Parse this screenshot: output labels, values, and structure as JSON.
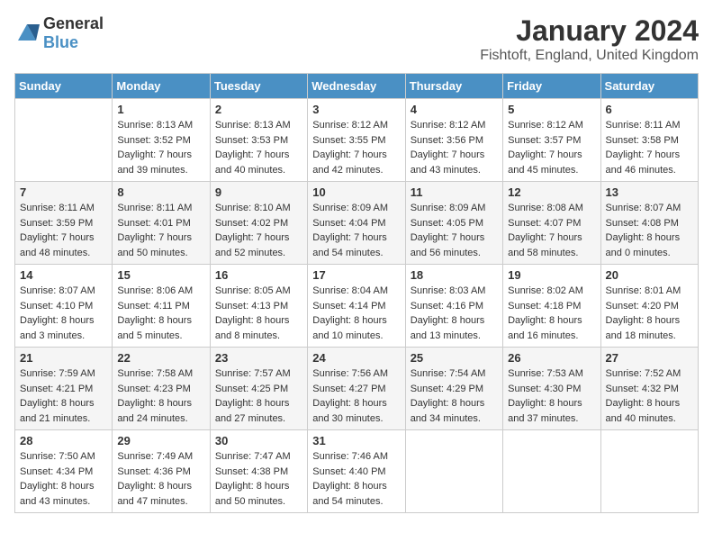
{
  "header": {
    "logo_general": "General",
    "logo_blue": "Blue",
    "month_title": "January 2024",
    "location": "Fishtoft, England, United Kingdom"
  },
  "weekdays": [
    "Sunday",
    "Monday",
    "Tuesday",
    "Wednesday",
    "Thursday",
    "Friday",
    "Saturday"
  ],
  "weeks": [
    [
      {
        "day": "",
        "sunrise": "",
        "sunset": "",
        "daylight": ""
      },
      {
        "day": "1",
        "sunrise": "Sunrise: 8:13 AM",
        "sunset": "Sunset: 3:52 PM",
        "daylight": "Daylight: 7 hours and 39 minutes."
      },
      {
        "day": "2",
        "sunrise": "Sunrise: 8:13 AM",
        "sunset": "Sunset: 3:53 PM",
        "daylight": "Daylight: 7 hours and 40 minutes."
      },
      {
        "day": "3",
        "sunrise": "Sunrise: 8:12 AM",
        "sunset": "Sunset: 3:55 PM",
        "daylight": "Daylight: 7 hours and 42 minutes."
      },
      {
        "day": "4",
        "sunrise": "Sunrise: 8:12 AM",
        "sunset": "Sunset: 3:56 PM",
        "daylight": "Daylight: 7 hours and 43 minutes."
      },
      {
        "day": "5",
        "sunrise": "Sunrise: 8:12 AM",
        "sunset": "Sunset: 3:57 PM",
        "daylight": "Daylight: 7 hours and 45 minutes."
      },
      {
        "day": "6",
        "sunrise": "Sunrise: 8:11 AM",
        "sunset": "Sunset: 3:58 PM",
        "daylight": "Daylight: 7 hours and 46 minutes."
      }
    ],
    [
      {
        "day": "7",
        "sunrise": "Sunrise: 8:11 AM",
        "sunset": "Sunset: 3:59 PM",
        "daylight": "Daylight: 7 hours and 48 minutes."
      },
      {
        "day": "8",
        "sunrise": "Sunrise: 8:11 AM",
        "sunset": "Sunset: 4:01 PM",
        "daylight": "Daylight: 7 hours and 50 minutes."
      },
      {
        "day": "9",
        "sunrise": "Sunrise: 8:10 AM",
        "sunset": "Sunset: 4:02 PM",
        "daylight": "Daylight: 7 hours and 52 minutes."
      },
      {
        "day": "10",
        "sunrise": "Sunrise: 8:09 AM",
        "sunset": "Sunset: 4:04 PM",
        "daylight": "Daylight: 7 hours and 54 minutes."
      },
      {
        "day": "11",
        "sunrise": "Sunrise: 8:09 AM",
        "sunset": "Sunset: 4:05 PM",
        "daylight": "Daylight: 7 hours and 56 minutes."
      },
      {
        "day": "12",
        "sunrise": "Sunrise: 8:08 AM",
        "sunset": "Sunset: 4:07 PM",
        "daylight": "Daylight: 7 hours and 58 minutes."
      },
      {
        "day": "13",
        "sunrise": "Sunrise: 8:07 AM",
        "sunset": "Sunset: 4:08 PM",
        "daylight": "Daylight: 8 hours and 0 minutes."
      }
    ],
    [
      {
        "day": "14",
        "sunrise": "Sunrise: 8:07 AM",
        "sunset": "Sunset: 4:10 PM",
        "daylight": "Daylight: 8 hours and 3 minutes."
      },
      {
        "day": "15",
        "sunrise": "Sunrise: 8:06 AM",
        "sunset": "Sunset: 4:11 PM",
        "daylight": "Daylight: 8 hours and 5 minutes."
      },
      {
        "day": "16",
        "sunrise": "Sunrise: 8:05 AM",
        "sunset": "Sunset: 4:13 PM",
        "daylight": "Daylight: 8 hours and 8 minutes."
      },
      {
        "day": "17",
        "sunrise": "Sunrise: 8:04 AM",
        "sunset": "Sunset: 4:14 PM",
        "daylight": "Daylight: 8 hours and 10 minutes."
      },
      {
        "day": "18",
        "sunrise": "Sunrise: 8:03 AM",
        "sunset": "Sunset: 4:16 PM",
        "daylight": "Daylight: 8 hours and 13 minutes."
      },
      {
        "day": "19",
        "sunrise": "Sunrise: 8:02 AM",
        "sunset": "Sunset: 4:18 PM",
        "daylight": "Daylight: 8 hours and 16 minutes."
      },
      {
        "day": "20",
        "sunrise": "Sunrise: 8:01 AM",
        "sunset": "Sunset: 4:20 PM",
        "daylight": "Daylight: 8 hours and 18 minutes."
      }
    ],
    [
      {
        "day": "21",
        "sunrise": "Sunrise: 7:59 AM",
        "sunset": "Sunset: 4:21 PM",
        "daylight": "Daylight: 8 hours and 21 minutes."
      },
      {
        "day": "22",
        "sunrise": "Sunrise: 7:58 AM",
        "sunset": "Sunset: 4:23 PM",
        "daylight": "Daylight: 8 hours and 24 minutes."
      },
      {
        "day": "23",
        "sunrise": "Sunrise: 7:57 AM",
        "sunset": "Sunset: 4:25 PM",
        "daylight": "Daylight: 8 hours and 27 minutes."
      },
      {
        "day": "24",
        "sunrise": "Sunrise: 7:56 AM",
        "sunset": "Sunset: 4:27 PM",
        "daylight": "Daylight: 8 hours and 30 minutes."
      },
      {
        "day": "25",
        "sunrise": "Sunrise: 7:54 AM",
        "sunset": "Sunset: 4:29 PM",
        "daylight": "Daylight: 8 hours and 34 minutes."
      },
      {
        "day": "26",
        "sunrise": "Sunrise: 7:53 AM",
        "sunset": "Sunset: 4:30 PM",
        "daylight": "Daylight: 8 hours and 37 minutes."
      },
      {
        "day": "27",
        "sunrise": "Sunrise: 7:52 AM",
        "sunset": "Sunset: 4:32 PM",
        "daylight": "Daylight: 8 hours and 40 minutes."
      }
    ],
    [
      {
        "day": "28",
        "sunrise": "Sunrise: 7:50 AM",
        "sunset": "Sunset: 4:34 PM",
        "daylight": "Daylight: 8 hours and 43 minutes."
      },
      {
        "day": "29",
        "sunrise": "Sunrise: 7:49 AM",
        "sunset": "Sunset: 4:36 PM",
        "daylight": "Daylight: 8 hours and 47 minutes."
      },
      {
        "day": "30",
        "sunrise": "Sunrise: 7:47 AM",
        "sunset": "Sunset: 4:38 PM",
        "daylight": "Daylight: 8 hours and 50 minutes."
      },
      {
        "day": "31",
        "sunrise": "Sunrise: 7:46 AM",
        "sunset": "Sunset: 4:40 PM",
        "daylight": "Daylight: 8 hours and 54 minutes."
      },
      {
        "day": "",
        "sunrise": "",
        "sunset": "",
        "daylight": ""
      },
      {
        "day": "",
        "sunrise": "",
        "sunset": "",
        "daylight": ""
      },
      {
        "day": "",
        "sunrise": "",
        "sunset": "",
        "daylight": ""
      }
    ]
  ]
}
